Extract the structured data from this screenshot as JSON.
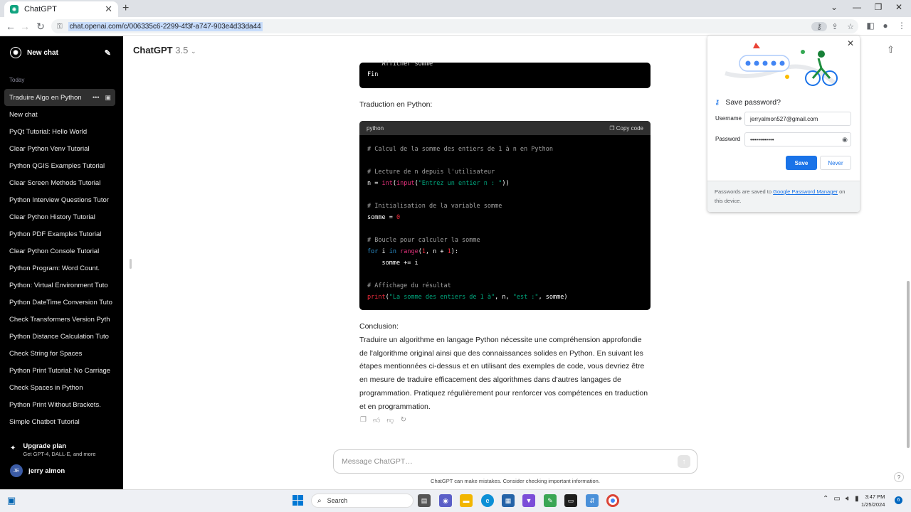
{
  "browser": {
    "tab_title": "ChatGPT",
    "url": "chat.openai.com/c/006335c6-2299-4f3f-a747-903e4d33da44"
  },
  "sidebar": {
    "new_chat": "New chat",
    "section_today": "Today",
    "chats": [
      "Traduire Algo en Python",
      "New chat",
      "PyQt Tutorial: Hello World",
      "Clear Python Venv Tutorial",
      "Python QGIS Examples Tutorial",
      "Clear Screen Methods Tutorial",
      "Python Interview Questions Tutor",
      "Clear Python History Tutorial",
      "Python PDF Examples Tutorial",
      "Clear Python Console Tutorial",
      "Python Program: Word Count.",
      "Python: Virtual Environment Tuto",
      "Python DateTime Conversion Tuto",
      "Check Transformers Version Pyth",
      "Python Distance Calculation Tuto",
      "Check String for Spaces",
      "Python Print Tutorial: No Carriage",
      "Check Spaces in Python",
      "Python Print Without Brackets.",
      "Simple Chatbot Tutorial"
    ],
    "upgrade_title": "Upgrade plan",
    "upgrade_sub": "Get GPT-4, DALL·E, and more",
    "user_initials": "JE",
    "user_name": "jerry almon"
  },
  "main": {
    "model_name": "ChatGPT",
    "model_version": "3.5",
    "code1_line1": "    Afficher somme",
    "code1_line2": "Fin",
    "translation_label": "Traduction en Python:",
    "code_lang": "python",
    "copy_code": "Copy code",
    "code": {
      "c1": "# Calcul de la somme des entiers de 1 à n en Python",
      "c2": "# Lecture de n depuis l'utilisateur",
      "l3a": "n = ",
      "l3b": "int",
      "l3c": "(",
      "l3d": "input",
      "l3e": "(",
      "l3f": "\"Entrez un entier n : \"",
      "l3g": "))",
      "c4": "# Initialisation de la variable somme",
      "l5a": "somme = ",
      "l5b": "0",
      "c6": "# Boucle pour calculer la somme",
      "l7a": "for",
      "l7b": " i ",
      "l7c": "in",
      "l7d": " ",
      "l7e": "range",
      "l7f": "(",
      "l7g": "1",
      "l7h": ", n + ",
      "l7i": "1",
      "l7j": "):",
      "l8": "    somme += i",
      "c9": "# Affichage du résultat",
      "l10a": "print",
      "l10b": "(",
      "l10c": "\"La somme des entiers de 1 à\"",
      "l10d": ", n, ",
      "l10e": "\"est :\"",
      "l10f": ", somme)"
    },
    "conclusion_label": "Conclusion:",
    "conclusion_text": "Traduire un algorithme en langage Python nécessite une compréhension approfondie de l'algorithme original ainsi que des connaissances solides en Python. En suivant les étapes mentionnées ci-dessus et en utilisant des exemples de code, vous devriez être en mesure de traduire efficacement des algorithmes dans d'autres langages de programmation. Pratiquez régulièrement pour renforcer vos compétences en traduction et en programmation.",
    "composer_placeholder": "Message ChatGPT…",
    "disclaimer": "ChatGPT can make mistakes. Consider checking important information."
  },
  "password_popup": {
    "title": "Save password?",
    "username_label": "Username",
    "username_value": "jerryalmon527@gmail.com",
    "password_label": "Password",
    "password_value": "••••••••••••",
    "save": "Save",
    "never": "Never",
    "footer_pre": "Passwords are saved to ",
    "footer_link": "Google Password Manager",
    "footer_post": " on this device."
  },
  "taskbar": {
    "search": "Search",
    "time": "3:47 PM",
    "date": "1/25/2024",
    "notifications": "6"
  },
  "colors": {
    "accent": "#10a37f",
    "chrome_blue": "#1a73e8",
    "sidebar_bg": "#000000"
  }
}
